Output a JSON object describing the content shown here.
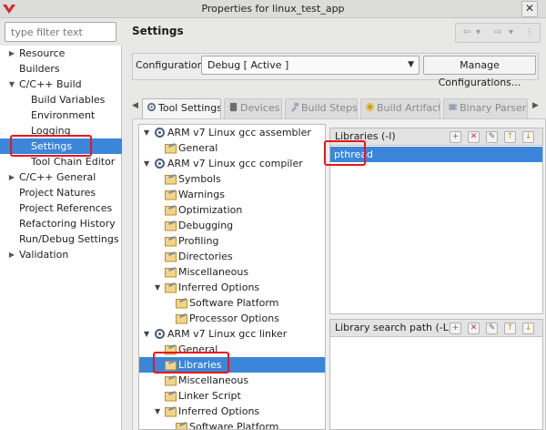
{
  "window": {
    "title": "Properties for linux_test_app",
    "close_glyph": "✕"
  },
  "filter": {
    "placeholder": "type filter text"
  },
  "nav": {
    "items": [
      {
        "label": "Resource",
        "arrow": "▶"
      },
      {
        "label": "Builders",
        "arrow": ""
      },
      {
        "label": "C/C++ Build",
        "arrow": "▼"
      },
      {
        "label": "Build Variables",
        "arrow": ""
      },
      {
        "label": "Environment",
        "arrow": ""
      },
      {
        "label": "Logging",
        "arrow": ""
      },
      {
        "label": "Settings",
        "arrow": ""
      },
      {
        "label": "Tool Chain Editor",
        "arrow": ""
      },
      {
        "label": "C/C++ General",
        "arrow": "▶"
      },
      {
        "label": "Project Natures",
        "arrow": ""
      },
      {
        "label": "Project References",
        "arrow": ""
      },
      {
        "label": "Refactoring History",
        "arrow": ""
      },
      {
        "label": "Run/Debug Settings",
        "arrow": ""
      },
      {
        "label": "Validation",
        "arrow": "▶"
      }
    ]
  },
  "page": {
    "title": "Settings"
  },
  "history": {
    "back": "⇦",
    "back_menu": "▾",
    "forward": "⇨",
    "forward_menu": "▾",
    "menu": "⋮"
  },
  "config": {
    "label": "Configuration:",
    "value": "Debug  [ Active ]",
    "manage_label": "Manage Configurations..."
  },
  "tabs": [
    {
      "label": "Tool Settings"
    },
    {
      "label": "Devices"
    },
    {
      "label": "Build Steps"
    },
    {
      "label": "Build Artifact"
    },
    {
      "label": "Binary Parsers"
    }
  ],
  "tool_tree": {
    "items": [
      {
        "label": "ARM v7 Linux gcc assembler",
        "arrow": "▼"
      },
      {
        "label": "General",
        "arrow": ""
      },
      {
        "label": "ARM v7 Linux gcc compiler",
        "arrow": "▼"
      },
      {
        "label": "Symbols",
        "arrow": ""
      },
      {
        "label": "Warnings",
        "arrow": ""
      },
      {
        "label": "Optimization",
        "arrow": ""
      },
      {
        "label": "Debugging",
        "arrow": ""
      },
      {
        "label": "Profiling",
        "arrow": ""
      },
      {
        "label": "Directories",
        "arrow": ""
      },
      {
        "label": "Miscellaneous",
        "arrow": ""
      },
      {
        "label": "Inferred Options",
        "arrow": "▼"
      },
      {
        "label": "Software Platform",
        "arrow": ""
      },
      {
        "label": "Processor Options",
        "arrow": ""
      },
      {
        "label": "ARM v7 Linux gcc linker",
        "arrow": "▼"
      },
      {
        "label": "General",
        "arrow": ""
      },
      {
        "label": "Libraries",
        "arrow": ""
      },
      {
        "label": "Miscellaneous",
        "arrow": ""
      },
      {
        "label": "Linker Script",
        "arrow": ""
      },
      {
        "label": "Inferred Options",
        "arrow": "▼"
      },
      {
        "label": "Software Platform",
        "arrow": ""
      }
    ]
  },
  "libraries": {
    "title": "Libraries (-l)",
    "items": [
      "pthread"
    ]
  },
  "library_paths": {
    "title": "Library search path (-L)",
    "items": []
  },
  "colors": {
    "selection": "#3b86d9",
    "annotation": "#e8161c"
  }
}
